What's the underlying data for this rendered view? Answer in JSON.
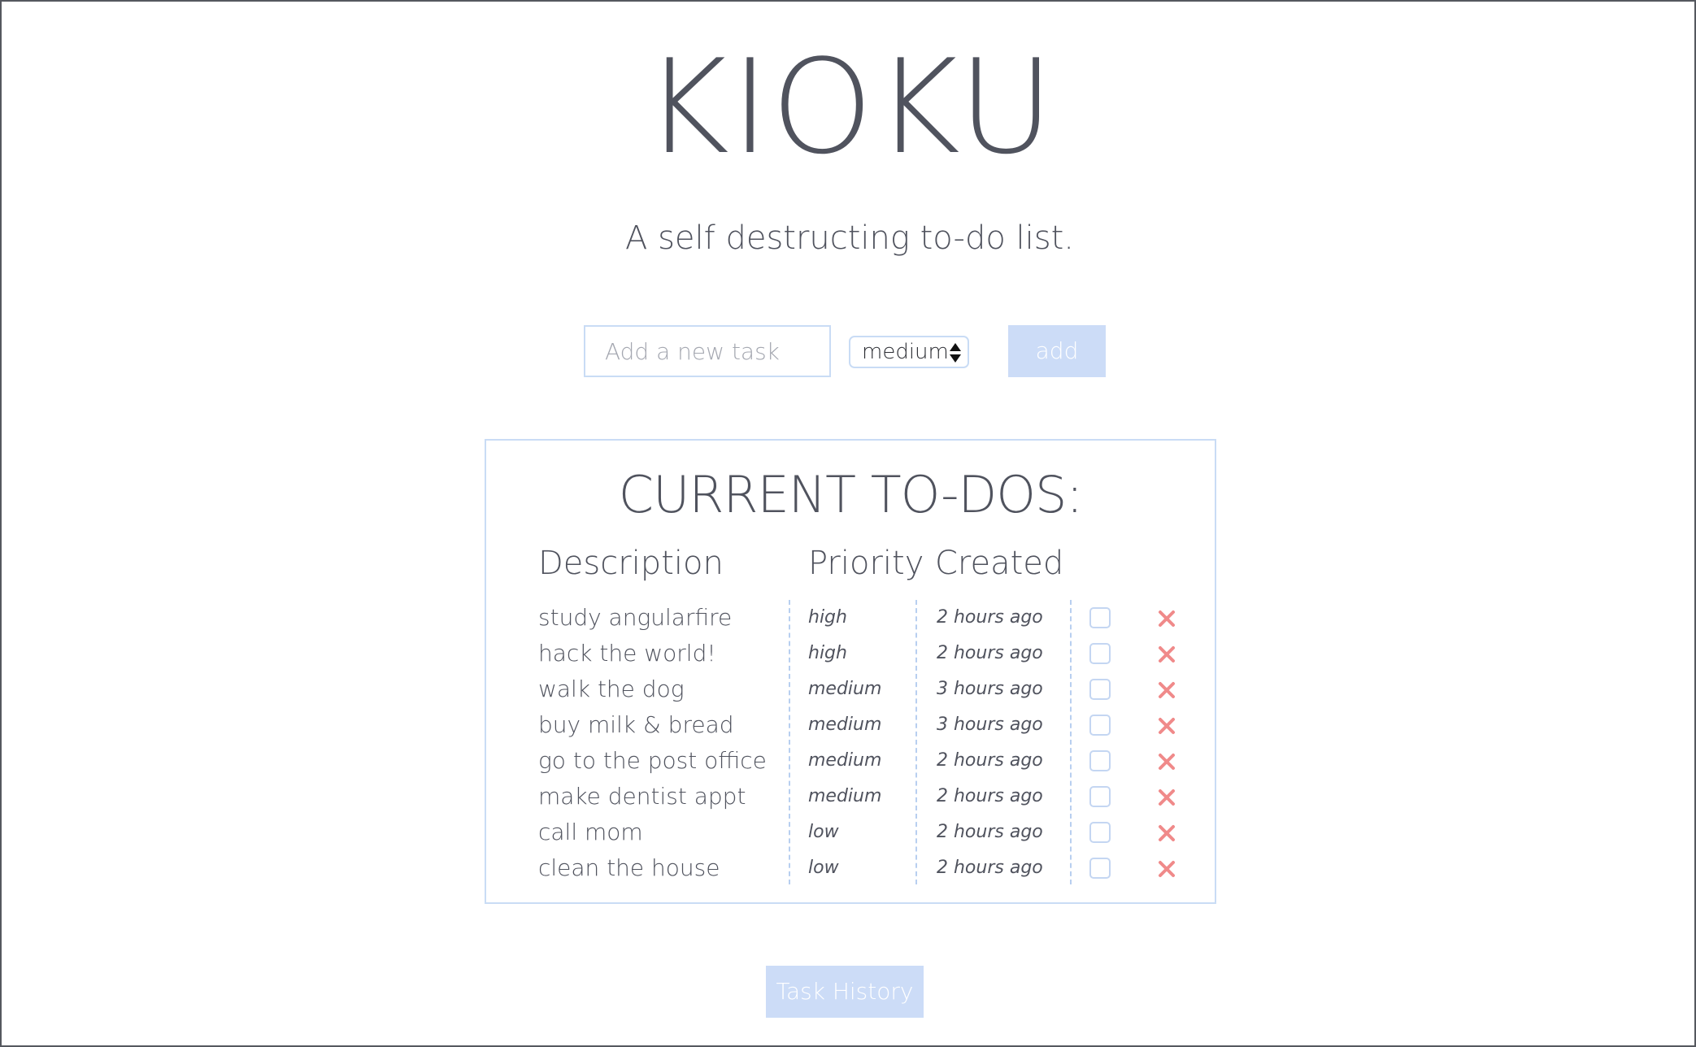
{
  "app": {
    "title": "KIOKU",
    "tagline": "A self destructing to-do list."
  },
  "new_task": {
    "placeholder": "Add a new task",
    "value": "",
    "priority_selected": "medium",
    "add_label": "add"
  },
  "todos": {
    "heading": "CURRENT TO-DOS:",
    "columns": {
      "description": "Description",
      "priority": "Priority",
      "created": "Created"
    },
    "items": [
      {
        "description": "study angularfire",
        "priority": "high",
        "created": "2 hours ago",
        "done": false
      },
      {
        "description": "hack the world!",
        "priority": "high",
        "created": "2 hours ago",
        "done": false
      },
      {
        "description": "walk the dog",
        "priority": "medium",
        "created": "3 hours ago",
        "done": false
      },
      {
        "description": "buy milk & bread",
        "priority": "medium",
        "created": "3 hours ago",
        "done": false
      },
      {
        "description": "go to the post office",
        "priority": "medium",
        "created": "2 hours ago",
        "done": false
      },
      {
        "description": "make dentist appt",
        "priority": "medium",
        "created": "2 hours ago",
        "done": false
      },
      {
        "description": "call mom",
        "priority": "low",
        "created": "2 hours ago",
        "done": false
      },
      {
        "description": "clean the house",
        "priority": "low",
        "created": "2 hours ago",
        "done": false
      }
    ],
    "delete_icon": "close-icon",
    "delete_color": "#f08a8a"
  },
  "footer": {
    "history_label": "Task History"
  },
  "colors": {
    "accent": "#ccdcf7",
    "border": "#c9dcf5",
    "text": "#50535e"
  }
}
